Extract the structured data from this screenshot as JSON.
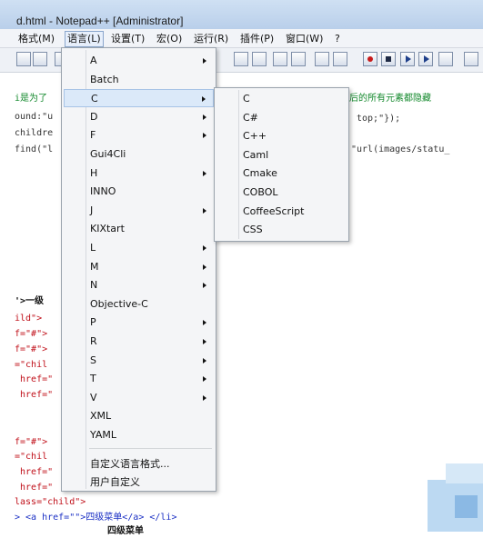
{
  "window": {
    "title": "d.html - Notepad++ [Administrator]"
  },
  "menubar": {
    "items": [
      "格式(M)",
      "语言(L)",
      "设置(T)",
      "宏(O)",
      "运行(R)",
      "插件(P)",
      "窗口(W)",
      "?"
    ]
  },
  "language_menu": {
    "items": [
      {
        "label": "A",
        "submenu": true
      },
      {
        "label": "Batch",
        "submenu": false
      },
      {
        "label": "C",
        "submenu": true
      },
      {
        "label": "D",
        "submenu": true
      },
      {
        "label": "F",
        "submenu": true
      },
      {
        "label": "Gui4Cli",
        "submenu": false
      },
      {
        "label": "H",
        "submenu": true
      },
      {
        "label": "INNO",
        "submenu": false
      },
      {
        "label": "J",
        "submenu": true
      },
      {
        "label": "KIXtart",
        "submenu": false
      },
      {
        "label": "L",
        "submenu": true
      },
      {
        "label": "M",
        "submenu": true
      },
      {
        "label": "N",
        "submenu": true
      },
      {
        "label": "Objective-C",
        "submenu": false
      },
      {
        "label": "P",
        "submenu": true
      },
      {
        "label": "R",
        "submenu": true
      },
      {
        "label": "S",
        "submenu": true
      },
      {
        "label": "T",
        "submenu": true
      },
      {
        "label": "V",
        "submenu": true
      },
      {
        "label": "XML",
        "submenu": false
      },
      {
        "label": "YAML",
        "submenu": false
      }
    ],
    "footer_items": [
      "自定义语言格式...",
      "用户自定义"
    ],
    "highlighted": "C"
  },
  "c_submenu": {
    "items": [
      "C",
      "C#",
      "C++",
      "Caml",
      "Cmake",
      "COBOL",
      "CoffeeScript",
      "CSS"
    ]
  },
  "editor": {
    "lines": [
      {
        "text": "i是为了",
        "cls": "comment"
      },
      {
        "text": "ound:\"u",
        "cls": ""
      },
      {
        "text": "childre",
        "cls": ""
      },
      {
        "text": "find(\"l",
        "cls": ""
      },
      {
        "text": "后的所有元素都隐藏",
        "cls": "comment"
      },
      {
        "text": "top;\"});",
        "cls": ""
      },
      {
        "text": "\"url(images/statu_",
        "cls": ""
      },
      {
        "text": "'>一级",
        "cls": "bold"
      },
      {
        "text": "ild\">",
        "cls": "attr"
      },
      {
        "text": "f=\"#\">",
        "cls": "attr"
      },
      {
        "text": "f=\"#\">",
        "cls": "attr"
      },
      {
        "text": "=\"chil",
        "cls": "attr"
      },
      {
        "text": " href=\"",
        "cls": "attr"
      },
      {
        "text": " href=\"",
        "cls": "attr"
      },
      {
        "text": "f=\"#\">",
        "cls": "attr"
      },
      {
        "text": "=\"chil",
        "cls": "attr"
      },
      {
        "text": " href=\"",
        "cls": "attr"
      },
      {
        "text": " href=\"",
        "cls": "attr"
      },
      {
        "text": "lass=\"child\">",
        "cls": "attr"
      },
      {
        "text": "> <a href=\"\">四级菜单</a> </li>",
        "cls": "tag"
      },
      {
        "text": "四级菜单",
        "cls": "bold"
      }
    ]
  }
}
